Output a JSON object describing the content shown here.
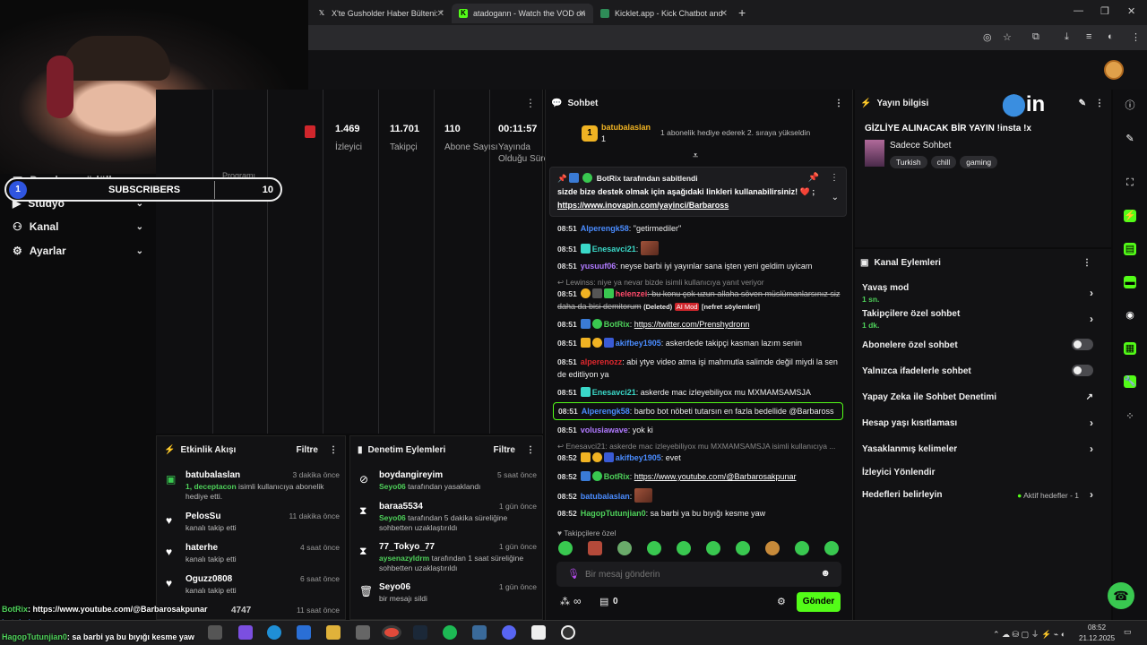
{
  "browser": {
    "tabs": [
      {
        "title": "X'te Gusholder Haber Bülteni: \"",
        "icon": "x-logo"
      },
      {
        "title": "atadogann - Watch the VOD on",
        "icon": "kick-logo"
      },
      {
        "title": "Kicklet.app - Kick Chatbot and",
        "icon": "kicklet-logo"
      }
    ],
    "close_glyph": "✕",
    "new_tab_glyph": "+",
    "window_controls": [
      "—",
      "❐",
      "✕"
    ]
  },
  "subscribers_overlay": {
    "index": "1",
    "label": "SUBSCRIBERS",
    "count": "10"
  },
  "sidebar": {
    "items": [
      {
        "label": "Droplar ve ödüller",
        "icon": "gift-icon"
      },
      {
        "label": "Stüdyo",
        "icon": "studio-icon"
      },
      {
        "label": "Kanal",
        "icon": "users-icon"
      },
      {
        "label": "Ayarlar",
        "icon": "gear-icon"
      }
    ],
    "program_label": "Programı"
  },
  "stats": [
    {
      "value": "1.469",
      "label": "İzleyici"
    },
    {
      "value": "11.701",
      "label": "Takipçi"
    },
    {
      "value": "110",
      "label": "Abone Sayısı"
    },
    {
      "value": "00:11:57",
      "label": "Yayında Olduğu Süre"
    }
  ],
  "activity": {
    "title": "Etkinlik Akışı",
    "filter": "Filtre",
    "items": [
      {
        "name": "batubalaslan",
        "time": "3 dakika önce",
        "highlight": "1, deceptacon",
        "desc": " isimli kullanıcıya abonelik hediye etti.",
        "icon": "gift-icon"
      },
      {
        "name": "PelosSu",
        "time": "11 dakika önce",
        "highlight": "",
        "desc": "kanalı takip etti",
        "icon": "heart-icon"
      },
      {
        "name": "haterhe",
        "time": "4 saat önce",
        "highlight": "",
        "desc": "kanalı takip etti",
        "icon": "heart-icon"
      },
      {
        "name": "Oguzz0808",
        "time": "6 saat önce",
        "highlight": "",
        "desc": "kanalı takip etti",
        "icon": "heart-icon"
      },
      {
        "name": "4747",
        "time": "11 saat önce",
        "highlight": "",
        "desc": "",
        "icon": "heart-icon"
      }
    ]
  },
  "moderation": {
    "title": "Denetim Eylemleri",
    "filter": "Filtre",
    "items": [
      {
        "name": "boydangireyim",
        "time": "5 saat önce",
        "highlight": "Seyo06",
        "desc": " tarafından yasaklandı",
        "icon": "ban-icon"
      },
      {
        "name": "baraa5534",
        "time": "1 gün önce",
        "highlight": "Seyo06",
        "desc": " tarafından 5 dakika süreliğine sohbetten uzaklaştırıldı",
        "icon": "hourglass-icon"
      },
      {
        "name": "77_Tokyo_77",
        "time": "1 gün önce",
        "highlight": "aysenazyldrm",
        "desc": " tarafından 1 saat süreliğine sohbetten uzaklaştırıldı",
        "icon": "hourglass-icon"
      },
      {
        "name": "Seyo06",
        "time": "1 gün önce",
        "highlight": "",
        "desc": "bir mesajı sildi",
        "icon": "trash-icon"
      }
    ]
  },
  "chat": {
    "title": "Sohbet",
    "gifter": {
      "rank": "1",
      "name": "batubalaslan",
      "count": "1",
      "notice": "1 abonelik hediye ederek 2. sıraya yükseldin"
    },
    "pinned": {
      "by_user": "BotRix",
      "by_text": "tarafından sabitlendi",
      "text": "sizde bize destek olmak için aşağıdaki linkleri kullanabilirsiniz! ❤️ ;",
      "link": "https://www.inovapin.com/yayinci/Barbaross"
    },
    "messages": [
      {
        "time": "08:51",
        "user": "Alperengk58",
        "color": "#4a8cff",
        "text": ": \"getirmediler\""
      },
      {
        "time": "08:51",
        "user": "Enesavci21",
        "color": "#3ad8c8",
        "text": ":"
      },
      {
        "time": "08:51",
        "user": "yusuuf06",
        "color": "#b07aff",
        "text": ": neyse barbi iyi yayınlar sana işten yeni geldim uyicam"
      },
      {
        "reply": "Lewinss: niye ya nevar bizde isimli kullanıcıya yanıt veriyor"
      },
      {
        "time": "08:51",
        "user": "helenzei",
        "color": "#ff4a6a",
        "text": ": bu konu çok uzun allaha söven müslümanlarsınız siz daha da bisi demitorum",
        "deleted": "(Deleted)",
        "aimod": "AI Mod",
        "reason": "[nefret söylemleri]"
      },
      {
        "time": "08:51",
        "user": "BotRix",
        "color": "#4ed15a",
        "text": ": ",
        "link": "https://twitter.com/Prenshydronn"
      },
      {
        "time": "08:51",
        "user": "akifbey1905",
        "color": "#4a8cff",
        "text": ": askerdede takipçi kasman lazım senin"
      },
      {
        "time": "08:51",
        "user": "alperenozz",
        "color": "#e0282e",
        "text": ": abi ytye video atma işi mahmutla salimde değil miydi la sen de editliyon ya"
      },
      {
        "time": "08:51",
        "user": "Enesavci21",
        "color": "#3ad8c8",
        "text": ": askerde mac izleyebiliyox mu MXMAMSAMSJA"
      },
      {
        "time": "08:51",
        "user": "Alperengk58",
        "color": "#4a8cff",
        "text": ": barbo bot nöbeti tutarsın en fazla bedellide @Barbaross"
      },
      {
        "time": "08:51",
        "user": "volusiawave",
        "color": "#b07aff",
        "text": ": yok ki"
      },
      {
        "reply": "Enesavci21: askerde mac izleyebiliyox mu MXMAMSAMSJA isimli kullanıcıya ..."
      },
      {
        "time": "08:52",
        "user": "akifbey1905",
        "color": "#4a8cff",
        "text": ": evet"
      },
      {
        "time": "08:52",
        "user": "BotRix",
        "color": "#4ed15a",
        "text": ": ",
        "link": "https://www.youtube.com/@Barbarosakpunar"
      },
      {
        "time": "08:52",
        "user": "batubalaslan",
        "color": "#4a8cff",
        "text": ":"
      },
      {
        "time": "08:52",
        "user": "HagopTutunjian0",
        "color": "#4ed15a",
        "text": ": sa barbi ya bu bıyığı kesme yaw"
      }
    ],
    "followers_only": "Takipçilere özel",
    "input_placeholder": "Bir mesaj gönderin",
    "points": "0",
    "send_label": "Gönder",
    "infinity": "∞"
  },
  "stream_info": {
    "title": "Yayın bilgisi",
    "stream_title": "GİZLİYE ALINACAK BİR YAYIN !insta !x",
    "category": "Sadece Sohbet",
    "tags": [
      "Turkish",
      "chill",
      "gaming"
    ],
    "watermark": "in"
  },
  "channel_actions": {
    "title": "Kanal Eylemleri",
    "rows": [
      {
        "label": "Yavaş mod",
        "sub": "1 sn.",
        "control": "arrow"
      },
      {
        "label": "Takipçilere özel sohbet",
        "sub": "1 dk.",
        "control": "arrow"
      },
      {
        "label": "Abonelere özel sohbet",
        "sub": "",
        "control": "toggle"
      },
      {
        "label": "Yalnızca ifadelerle sohbet",
        "sub": "",
        "control": "toggle"
      },
      {
        "label": "Yapay Zeka ile Sohbet Denetimi",
        "sub": "",
        "control": "external"
      },
      {
        "label": "Hesap yaşı kısıtlaması",
        "sub": "",
        "control": "arrow"
      },
      {
        "label": "Yasaklanmış kelimeler",
        "sub": "",
        "control": "arrow"
      },
      {
        "label": "İzleyici Yönlendir",
        "sub": "",
        "control": "none"
      },
      {
        "label": "Hedefleri belirleyin",
        "sub": "",
        "control": "arrow",
        "status": "Aktif hedefler - 1"
      }
    ]
  },
  "overlay_chat": [
    {
      "user": "BotRix",
      "text": ": https://www.youtube.com/@Barbarosakpunar"
    },
    {
      "user": "batubalaslan",
      "text": ":"
    },
    {
      "user": "HagopTutunjian0",
      "text": ": sa barbi ya bu bıyığı kesme yaw"
    }
  ],
  "taskbar": {
    "time": "08:52",
    "date": "21.12.2025"
  },
  "colors": {
    "accent": "#53fc18",
    "kick_green": "#39c850",
    "bg": "#0b0b0c",
    "panel": "#121214"
  }
}
